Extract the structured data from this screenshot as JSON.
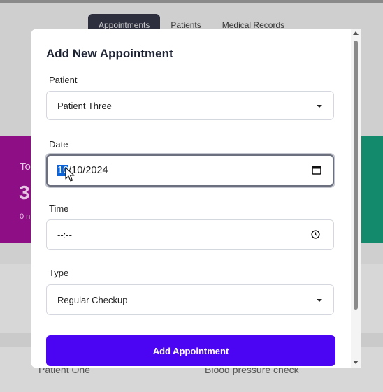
{
  "background": {
    "nav_tabs": [
      "Appointments",
      "Patients",
      "Medical Records"
    ],
    "card_left": {
      "label": "To",
      "value": "3",
      "sub": "0 n"
    },
    "rows": [
      "Patient One",
      "Blood pressure check"
    ],
    "colors": {
      "card_left": "#8e0f85",
      "card_right": "#138a6b",
      "active_tab": "#2d2f3e"
    }
  },
  "modal": {
    "title": "Add New Appointment",
    "patient": {
      "label": "Patient",
      "value": "Patient Three"
    },
    "date": {
      "label": "Date",
      "value_selected": "10",
      "value_rest": "/10/2024"
    },
    "time": {
      "label": "Time",
      "value": "--:--"
    },
    "type": {
      "label": "Type",
      "value": "Regular Checkup"
    },
    "submit_label": "Add Appointment",
    "accent_color": "#4b05f2",
    "icons": [
      "chevron-down-icon",
      "calendar-icon",
      "clock-icon",
      "mouse-cursor-icon"
    ]
  }
}
